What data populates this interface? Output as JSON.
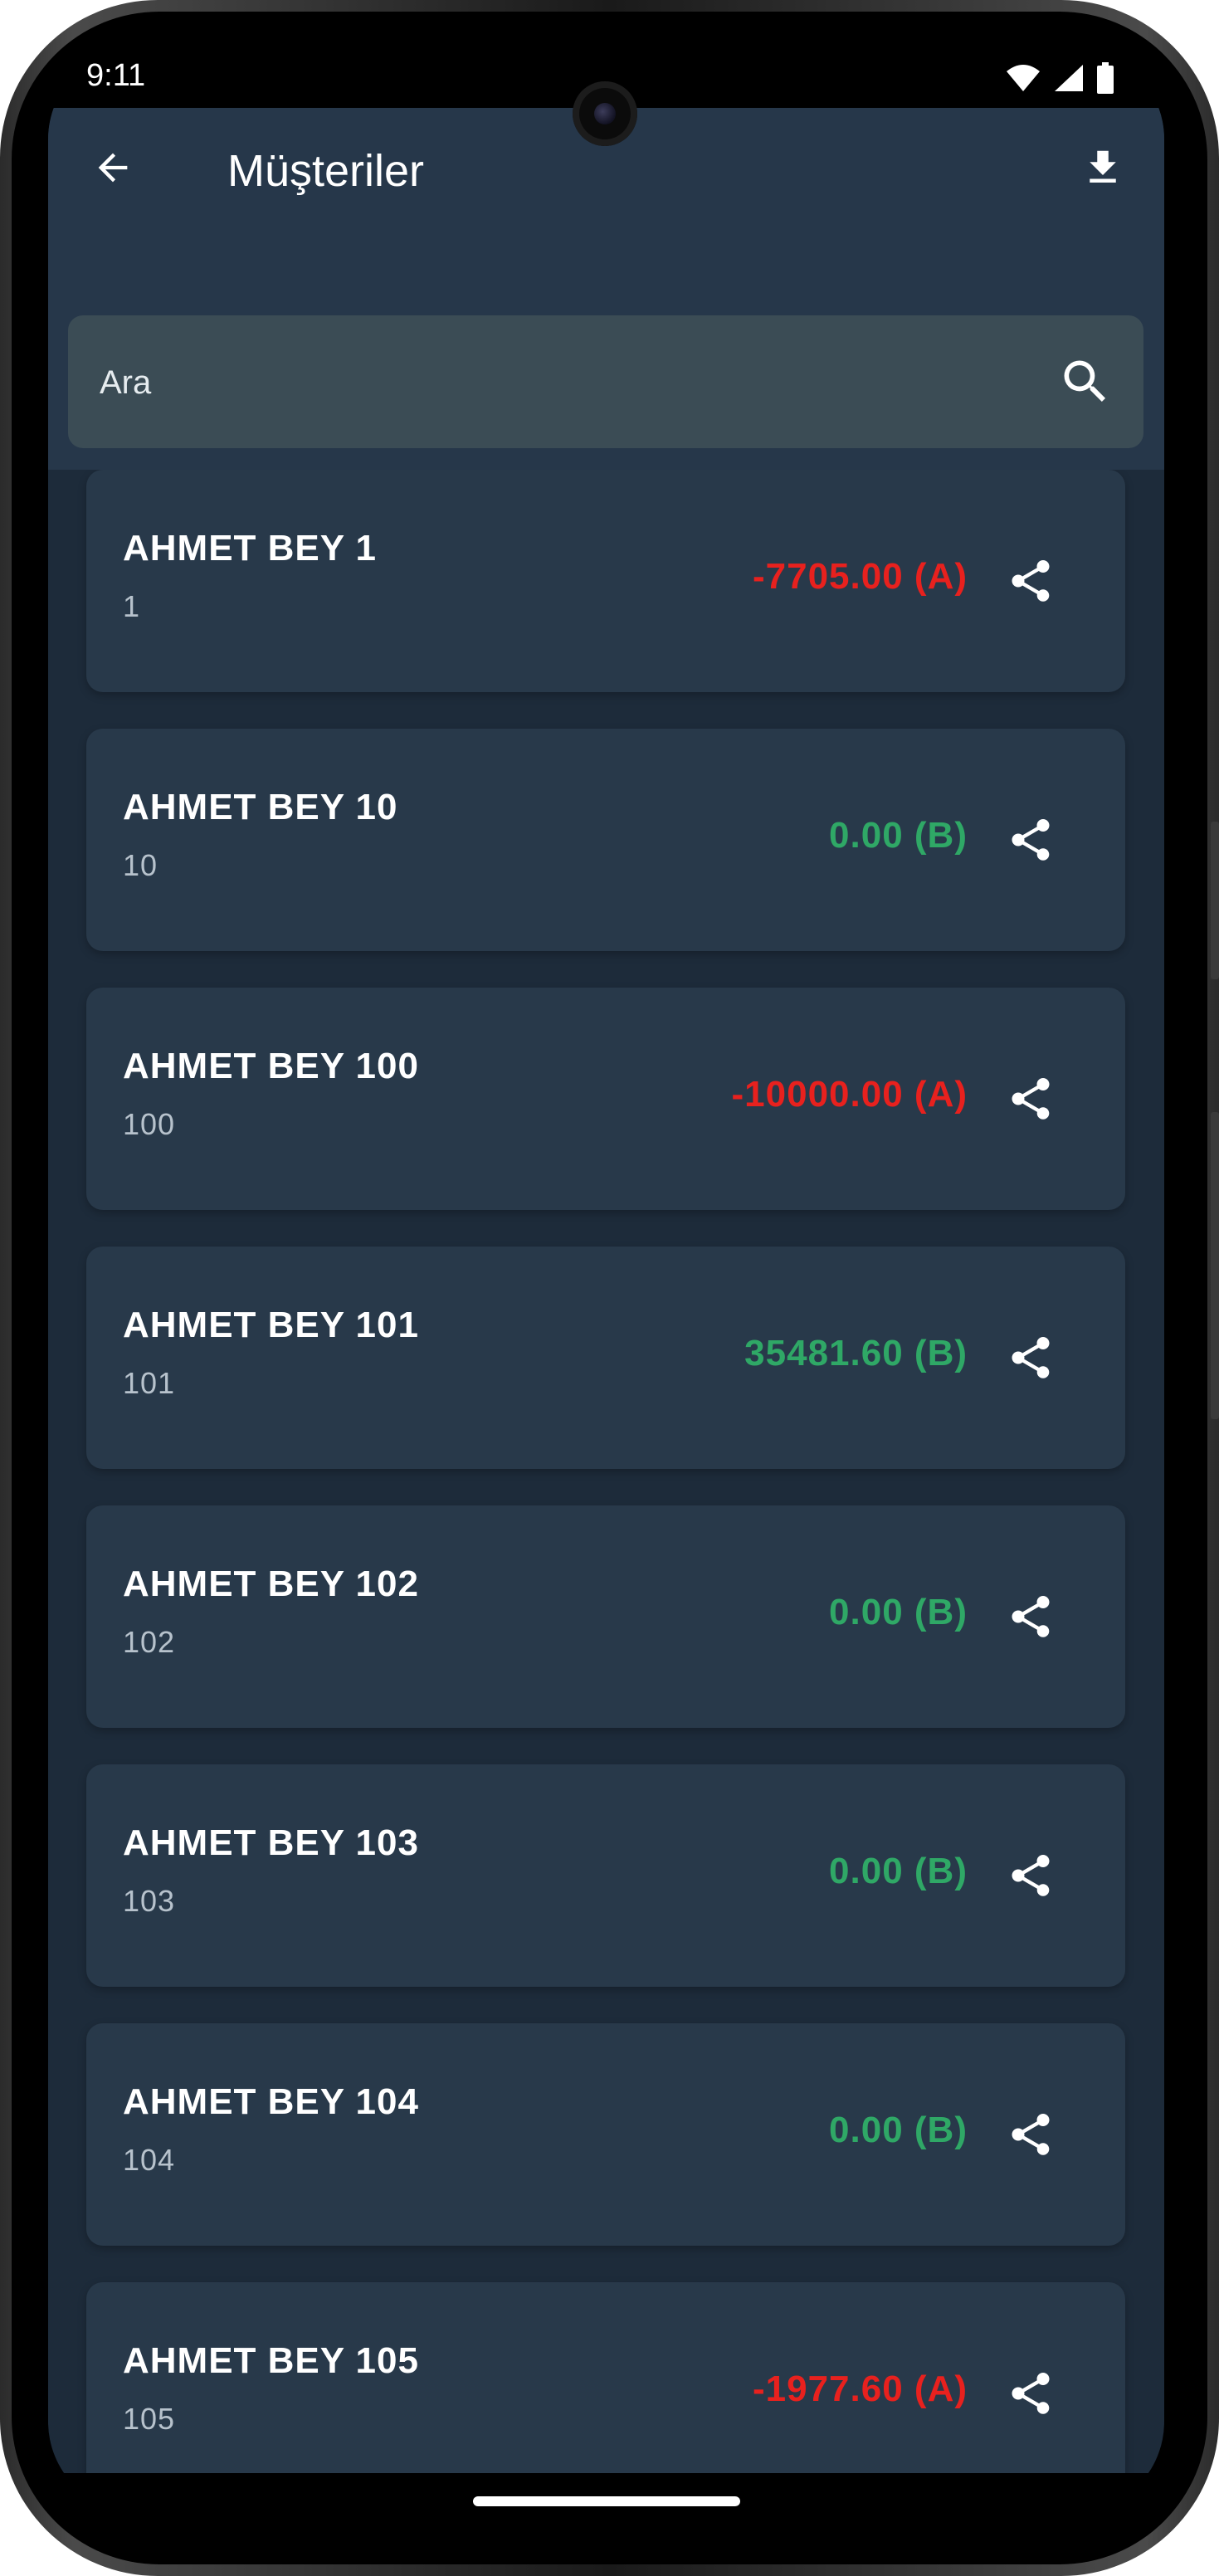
{
  "status_bar": {
    "time": "9:11",
    "icons": [
      "wifi-icon",
      "signal-icon",
      "battery-icon"
    ]
  },
  "app_bar": {
    "title": "Müşteriler",
    "back_icon": "arrow-back-icon",
    "download_icon": "download-icon"
  },
  "search": {
    "placeholder": "Ara",
    "value": ""
  },
  "colors": {
    "negative": "#e8211e",
    "positive": "#2fa866",
    "card_bg": "#28394a",
    "app_bar_bg": "#26374a",
    "page_bg": "#1d2b3a"
  },
  "customers": [
    {
      "name": "AHMET BEY 1",
      "code": "1",
      "amount": "-7705.00 (A)",
      "status": "negative"
    },
    {
      "name": "AHMET BEY 10",
      "code": "10",
      "amount": "0.00 (B)",
      "status": "positive"
    },
    {
      "name": "AHMET BEY 100",
      "code": "100",
      "amount": "-10000.00 (A)",
      "status": "negative"
    },
    {
      "name": "AHMET BEY 101",
      "code": "101",
      "amount": "35481.60 (B)",
      "status": "positive"
    },
    {
      "name": "AHMET BEY 102",
      "code": "102",
      "amount": "0.00 (B)",
      "status": "positive"
    },
    {
      "name": "AHMET BEY 103",
      "code": "103",
      "amount": "0.00 (B)",
      "status": "positive"
    },
    {
      "name": "AHMET BEY 104",
      "code": "104",
      "amount": "0.00 (B)",
      "status": "positive"
    },
    {
      "name": "AHMET BEY 105",
      "code": "105",
      "amount": "-1977.60 (A)",
      "status": "negative"
    }
  ]
}
